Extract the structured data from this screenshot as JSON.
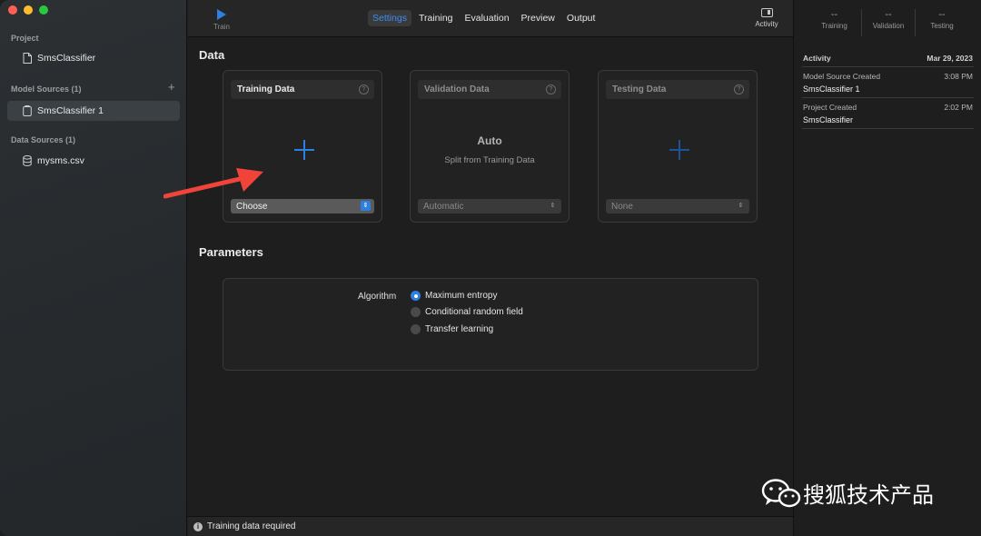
{
  "sidebar": {
    "project_heading": "Project",
    "project_item": "SmsClassifier",
    "model_sources_heading": "Model Sources (1)",
    "model_sources_add": "+",
    "model_source_item": "SmsClassifier 1",
    "data_sources_heading": "Data Sources (1)",
    "data_source_item": "mysms.csv"
  },
  "toolbar": {
    "train_label": "Train",
    "tabs": [
      {
        "label": "Settings",
        "active": true
      },
      {
        "label": "Training"
      },
      {
        "label": "Evaluation"
      },
      {
        "label": "Preview"
      },
      {
        "label": "Output"
      }
    ],
    "activity_label": "Activity"
  },
  "main": {
    "data_title": "Data",
    "cards": {
      "training": {
        "title": "Training Data",
        "select": "Choose"
      },
      "validation": {
        "title": "Validation Data",
        "auto": "Auto",
        "auto_sub": "Split from Training Data",
        "select": "Automatic"
      },
      "testing": {
        "title": "Testing Data",
        "select": "None"
      }
    },
    "help_glyph": "?",
    "parameters_title": "Parameters",
    "algorithm_label": "Algorithm",
    "algorithms": [
      {
        "label": "Maximum entropy",
        "selected": true
      },
      {
        "label": "Conditional random field",
        "selected": false
      },
      {
        "label": "Transfer learning",
        "selected": false
      }
    ]
  },
  "status": {
    "message": "Training data required",
    "icon": "info-icon"
  },
  "right_panel": {
    "metrics": [
      {
        "value": "--",
        "label": "Training"
      },
      {
        "value": "--",
        "label": "Validation"
      },
      {
        "value": "--",
        "label": "Testing"
      }
    ],
    "activity_heading": "Activity",
    "activity_date": "Mar 29, 2023",
    "entries": [
      {
        "event": "Model Source Created",
        "time": "3:08 PM",
        "name": "SmsClassifier 1"
      },
      {
        "event": "Project Created",
        "time": "2:02 PM",
        "name": "SmsClassifier"
      }
    ]
  },
  "watermark": {
    "text": "搜狐技术产品"
  },
  "colors": {
    "accent": "#2d7fe0",
    "sidebar_bg": "#2a2e31",
    "window_bg": "#1e1e1e",
    "annotation_arrow": "#f0443a"
  }
}
